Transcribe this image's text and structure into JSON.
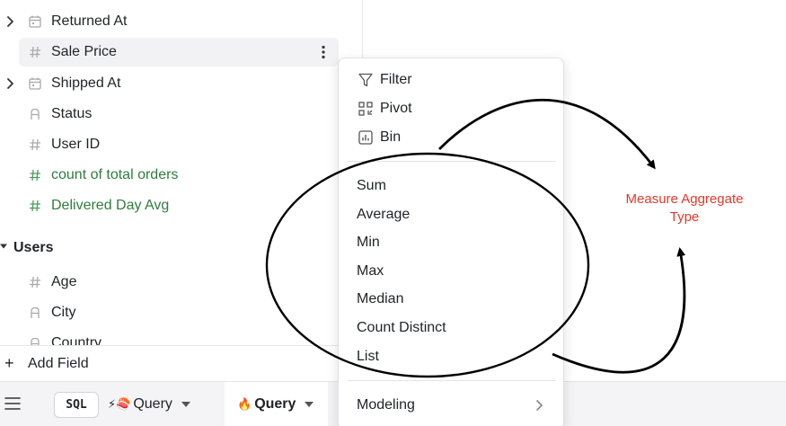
{
  "fields": {
    "rows": [
      {
        "label": "Returned At",
        "type": "date",
        "expandable": true
      },
      {
        "label": "Sale Price",
        "type": "number",
        "selected": true
      },
      {
        "label": "Shipped At",
        "type": "date",
        "expandable": true
      },
      {
        "label": "Status",
        "type": "string"
      },
      {
        "label": "User ID",
        "type": "number"
      },
      {
        "label": "count of total orders",
        "type": "measure"
      },
      {
        "label": "Delivered Day Avg",
        "type": "measure"
      }
    ],
    "group": {
      "label": "Users"
    },
    "group_rows": [
      {
        "label": "Age",
        "type": "number"
      },
      {
        "label": "City",
        "type": "string"
      },
      {
        "label": "Country",
        "type": "string"
      }
    ],
    "add_field": {
      "plus": "+",
      "label": "Add Field"
    }
  },
  "context_menu": {
    "transform_items": [
      {
        "label": "Filter",
        "icon": "filter-icon"
      },
      {
        "label": "Pivot",
        "icon": "pivot-icon"
      },
      {
        "label": "Bin",
        "icon": "bin-icon"
      }
    ],
    "aggregate_items": [
      {
        "label": "Sum"
      },
      {
        "label": "Average"
      },
      {
        "label": "Min"
      },
      {
        "label": "Max"
      },
      {
        "label": "Median"
      },
      {
        "label": "Count Distinct"
      },
      {
        "label": "List"
      }
    ],
    "footer_item": {
      "label": "Modeling",
      "icon": "chevron-right-icon"
    }
  },
  "tabbar": {
    "menu_icon": "hamburger-icon",
    "sql_label": "SQL",
    "tabs": [
      {
        "emoji": "⚡🍣",
        "label": "Query",
        "active": false
      },
      {
        "emoji": "🔥",
        "label": "Query",
        "active": true
      }
    ]
  },
  "annotation": {
    "label": "Measure Aggregate Type",
    "color": "#e03a2b"
  },
  "colors": {
    "measure": "#2e7d3e",
    "selected_row": "#f2f2f4",
    "tabbar_bg": "#f4f4f6"
  }
}
